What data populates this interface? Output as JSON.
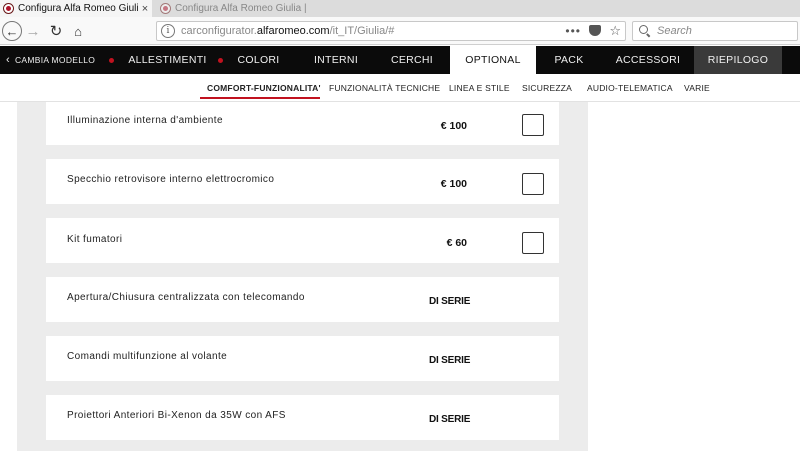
{
  "browser": {
    "active_tab_title": "Configura Alfa Romeo Giulia | C",
    "inactive_tab_title": "Configura Alfa Romeo Giulia | C",
    "tab_close": "×",
    "url_prefix": "carconfigurator.",
    "url_domain": "alfaromeo.com",
    "url_path": "/it_IT/Giulia/#",
    "url_menu": "•••",
    "search_placeholder": "Search",
    "icons": {
      "back": "back-arrow-icon",
      "forward": "forward-arrow-icon",
      "reload": "reload-icon",
      "home": "home-icon",
      "info": "info-icon",
      "pocket": "pocket-icon",
      "bookmark": "star-icon",
      "search": "search-icon"
    }
  },
  "mainmenu": {
    "back_label": "CAMBIA MODELLO",
    "items": [
      {
        "label": "ALLESTIMENTI",
        "dot": true
      },
      {
        "label": "COLORI",
        "dot": true
      },
      {
        "label": "INTERNI",
        "dot": false
      },
      {
        "label": "CERCHI",
        "dot": false
      },
      {
        "label": "OPTIONAL",
        "dot": false,
        "active": true
      },
      {
        "label": "PACK",
        "dot": false
      },
      {
        "label": "ACCESSORI",
        "dot": false
      },
      {
        "label": "RIEPILOGO",
        "dot": false
      }
    ],
    "accent_color": "#c1121f"
  },
  "submenu": {
    "items": [
      {
        "label": "COMFORT-FUNZIONALITA'",
        "active": true
      },
      {
        "label": "FUNZIONALITÀ TECNICHE"
      },
      {
        "label": "LINEA E STILE"
      },
      {
        "label": "SICUREZZA"
      },
      {
        "label": "AUDIO-TELEMATICA"
      },
      {
        "label": "VARIE"
      }
    ]
  },
  "options": [
    {
      "label": "Illuminazione interna d'ambiente",
      "price": "€ 100",
      "checked": false
    },
    {
      "label": "Specchio retrovisore interno elettrocromico",
      "price": "€ 100",
      "checked": false
    },
    {
      "label": "Kit fumatori",
      "price": "€ 60",
      "checked": false
    },
    {
      "label": "Apertura/Chiusura centralizzata con telecomando",
      "serie": "DI SERIE"
    },
    {
      "label": "Comandi multifunzione al volante",
      "serie": "DI SERIE"
    },
    {
      "label": "Proiettori Anteriori Bi-Xenon da 35W con AFS",
      "serie": "DI SERIE"
    }
  ]
}
